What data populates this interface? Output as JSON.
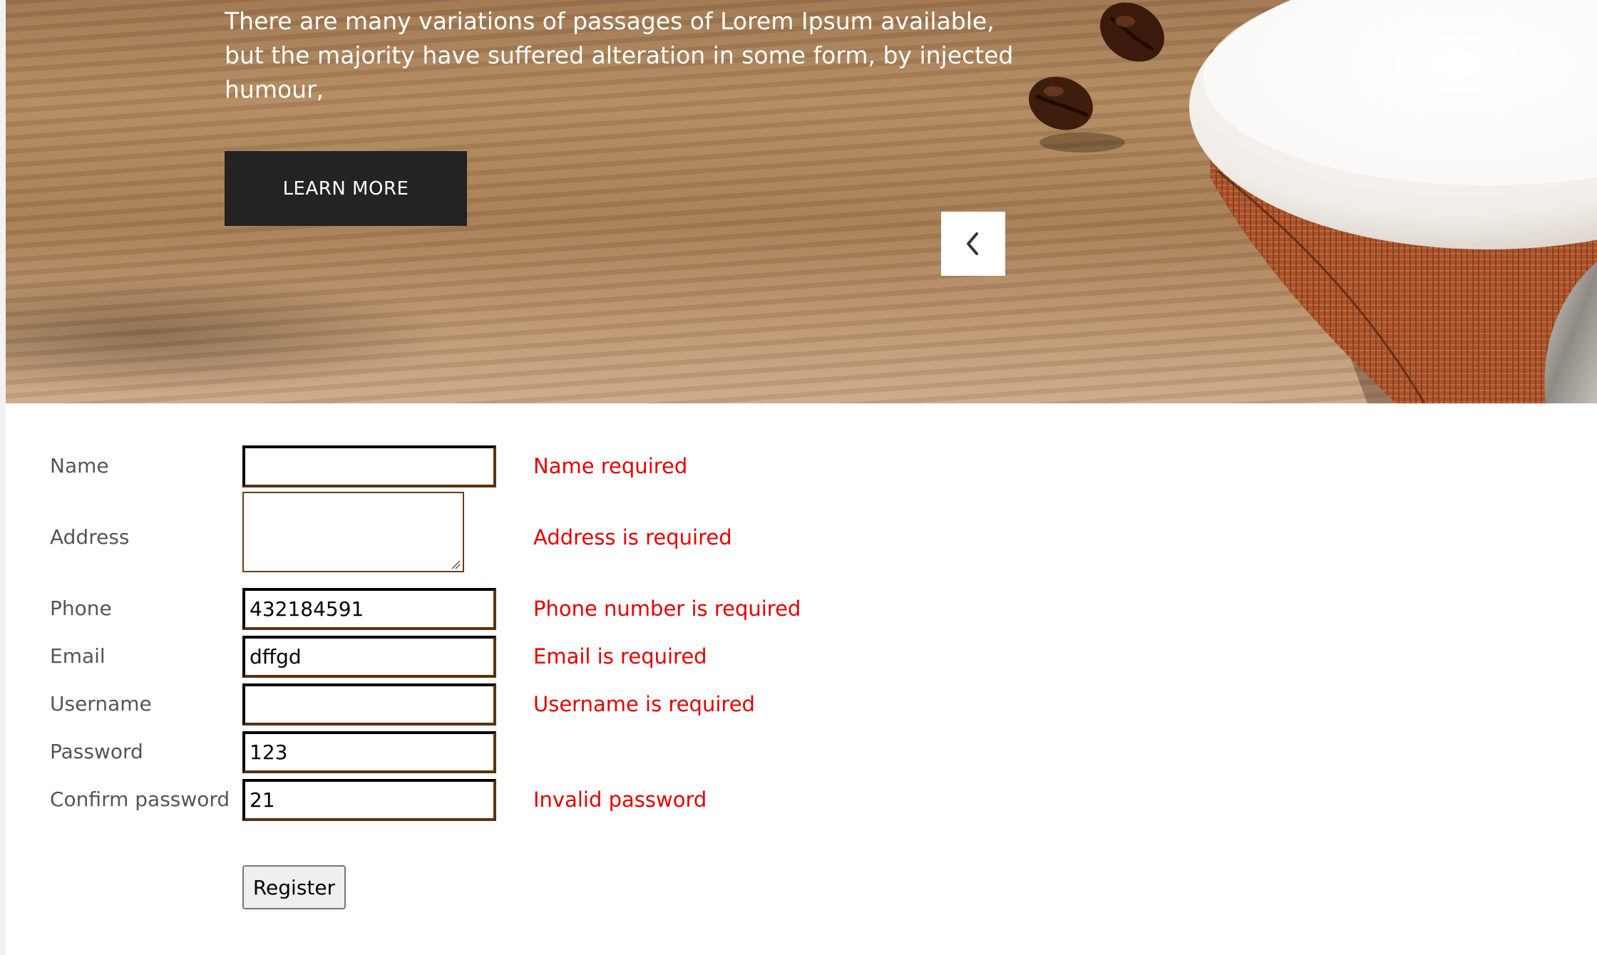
{
  "hero": {
    "text": "There are many variations of passages of Lorem Ipsum available, but the majority have suffered alteration in some form, by injected humour,",
    "learn_more_label": "LEARN MORE"
  },
  "form": {
    "labels": {
      "name": "Name",
      "address": "Address",
      "phone": "Phone",
      "email": "Email",
      "username": "Username",
      "password": "Password",
      "confirm_password": "Confirm password"
    },
    "values": {
      "name": "",
      "address": "",
      "phone": "432184591",
      "email": "dffgd",
      "username": "",
      "password": "123",
      "confirm_password": "21"
    },
    "errors": {
      "name": "Name required",
      "address": "Address is required",
      "phone": "Phone number is required",
      "email": "Email is required",
      "username": "Username is required",
      "confirm_password": "Invalid password"
    },
    "register_label": "Register"
  },
  "colors": {
    "error": "#e60000",
    "label": "#555555",
    "learn_more_bg": "#232323"
  },
  "icons": {
    "carousel_prev": "chevron-left-icon"
  }
}
